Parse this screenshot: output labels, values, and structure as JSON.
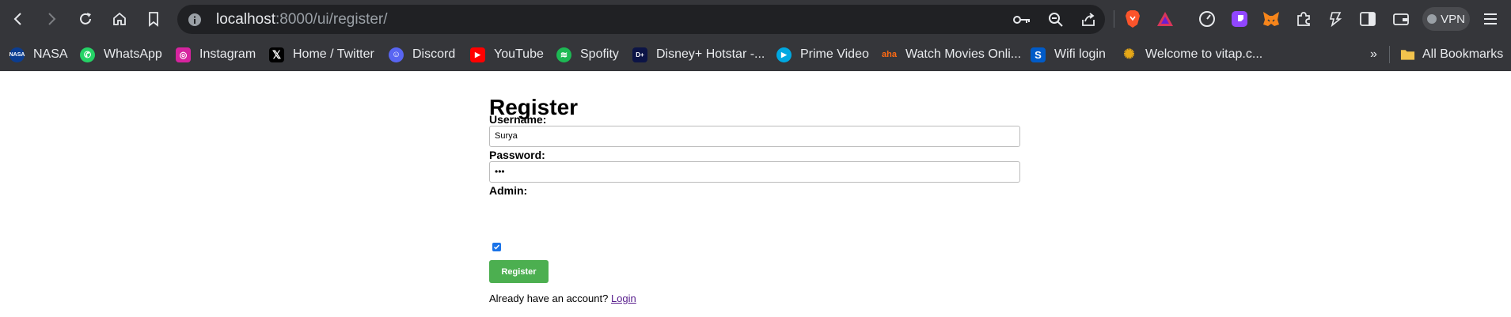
{
  "browser": {
    "url_host": "localhost",
    "url_rest": ":8000/ui/register/",
    "vpn_label": "VPN",
    "bookmarks": [
      {
        "label": "NASA",
        "icon": "nasa-icon"
      },
      {
        "label": "WhatsApp",
        "icon": "whatsapp-icon"
      },
      {
        "label": "Instagram",
        "icon": "instagram-icon"
      },
      {
        "label": "Home / Twitter",
        "icon": "x-icon"
      },
      {
        "label": "Discord",
        "icon": "discord-icon"
      },
      {
        "label": "YouTube",
        "icon": "youtube-icon"
      },
      {
        "label": "Spofity",
        "icon": "spotify-icon"
      },
      {
        "label": "Disney+ Hotstar -...",
        "icon": "hotstar-icon"
      },
      {
        "label": "Prime Video",
        "icon": "prime-video-icon"
      },
      {
        "label": "Watch Movies Onli...",
        "icon": "aha-icon"
      },
      {
        "label": "Wifi login",
        "icon": "sophos-icon"
      },
      {
        "label": "Welcome to vitap.c...",
        "icon": "vitap-icon"
      }
    ],
    "more_label": "»",
    "all_bookmarks_label": "All Bookmarks"
  },
  "page": {
    "title": "Register",
    "username_label": "Username:",
    "username_value": "Surya",
    "password_label": "Password:",
    "password_value": "•••",
    "admin_label": "Admin:",
    "admin_checked": true,
    "submit_label": "Register",
    "footer_text": "Already have an account?",
    "login_link": "Login"
  },
  "colors": {
    "chrome_bg": "#35363a",
    "omnibox_bg": "#202124",
    "button_green": "#4caf50",
    "link_purple": "#551a8b"
  }
}
